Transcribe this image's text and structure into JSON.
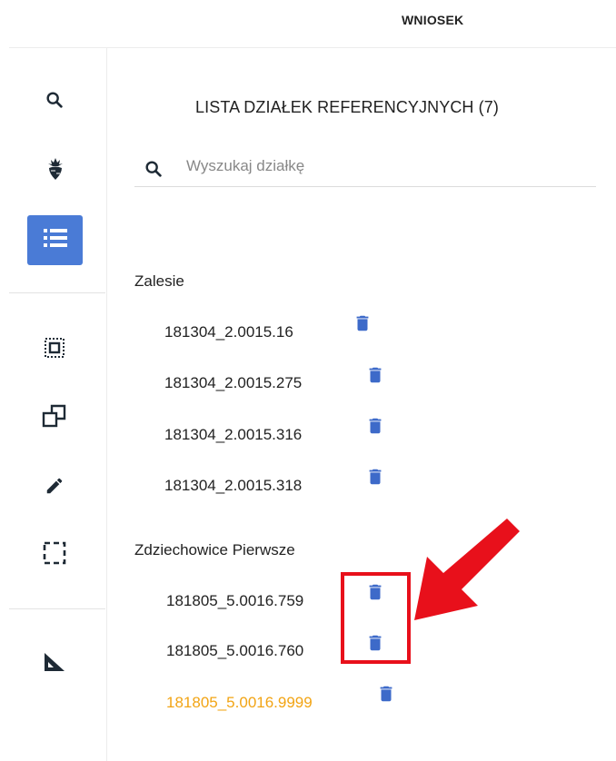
{
  "header": {
    "title": "WNIOSEK"
  },
  "sidebar": {
    "icons": [
      "search-icon",
      "beet-icon",
      "list-icon",
      "select-area-icon",
      "copy-shapes-icon",
      "pencil-icon",
      "dashed-rectangle-icon",
      "set-square-icon"
    ],
    "active": "list-icon",
    "accent_color": "#4a7bd6"
  },
  "list": {
    "title": "LISTA DZIAŁEK REFERENCYJNYCH (7)",
    "search_placeholder": "Wyszukaj działkę",
    "groups": [
      {
        "name": "Zalesie",
        "parcels": [
          "181304_2.0015.16",
          "181304_2.0015.275",
          "181304_2.0015.316",
          "181304_2.0015.318"
        ]
      },
      {
        "name": "Zdziechowice Pierwsze",
        "parcels": [
          "181805_5.0016.759",
          "181805_5.0016.760",
          "181805_5.0016.9999"
        ]
      }
    ],
    "highlight_color": "#f2a414",
    "trash_color": "#3d6ac9"
  },
  "annotation": {
    "color": "#e8101b"
  }
}
